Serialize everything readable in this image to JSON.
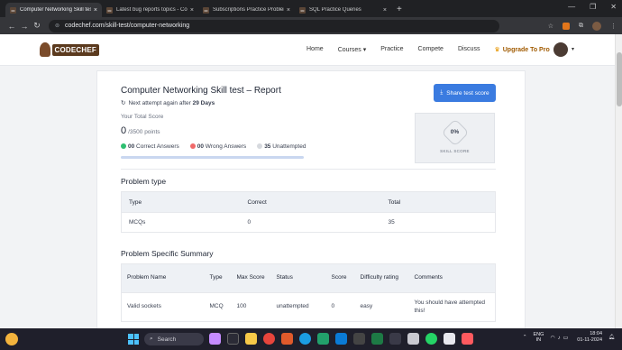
{
  "browser": {
    "tabs": [
      {
        "label": "Computer Networking Skill test",
        "active": true
      },
      {
        "label": "Latest bug reports topics - Co",
        "active": false
      },
      {
        "label": "Subscriptions Practice Problem",
        "active": false
      },
      {
        "label": "SQL Practice Queries",
        "active": false
      }
    ],
    "new_tab_glyph": "+",
    "url": "codechef.com/skill-test/computer-networking"
  },
  "site": {
    "logo_text": "CODECHEF",
    "nav": [
      "Home",
      "Courses",
      "Practice",
      "Compete",
      "Discuss"
    ],
    "upgrade_label": "Upgrade To Pro"
  },
  "report": {
    "title": "Computer Networking Skill test – Report",
    "next_attempt_prefix": "Next attempt again after",
    "next_attempt_value": "29 Days",
    "total_score_label": "Your Total Score",
    "score": "0",
    "score_out_of": "/3500 points",
    "correct_count": "00",
    "correct_label": "Correct Answers",
    "wrong_count": "00",
    "wrong_label": "Wrong Answers",
    "unattempted_count": "35",
    "unattempted_label": "Unattempted",
    "share_label": "Share test score",
    "skill_score_value": "0%",
    "skill_score_label": "SKILL SCORE"
  },
  "problem_type": {
    "title": "Problem type",
    "headers": [
      "Type",
      "Correct",
      "Total"
    ],
    "rows": [
      [
        "MCQs",
        "0",
        "35"
      ]
    ]
  },
  "summary": {
    "title": "Problem Specific Summary",
    "headers": [
      "Problem Name",
      "Type",
      "Max Score",
      "Status",
      "Score",
      "Difficulty rating",
      "Comments"
    ],
    "rows": [
      [
        "Valid sockets",
        "MCQ",
        "100",
        "unattempted",
        "0",
        "easy",
        "You should have attempted this!"
      ]
    ]
  },
  "taskbar": {
    "search_label": "Search",
    "lang_line1": "ENG",
    "lang_line2": "IN",
    "time": "18:04",
    "date": "01-11-2024"
  }
}
